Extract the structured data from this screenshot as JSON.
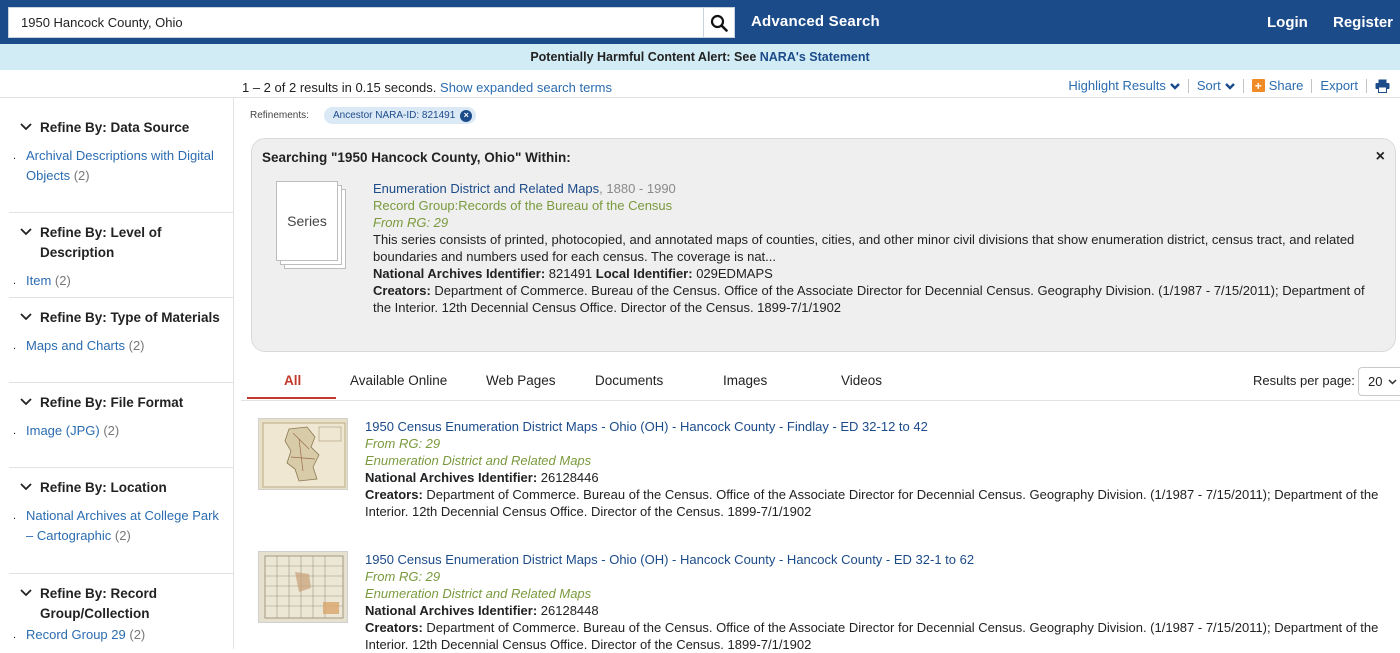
{
  "header": {
    "search_value": "1950 Hancock County, Ohio",
    "advanced_search": "Advanced Search",
    "login": "Login",
    "register": "Register"
  },
  "alert": {
    "text": "Potentially Harmful Content Alert: See ",
    "link": "NARA's Statement"
  },
  "results": {
    "summary": "1 – 2 of 2 results in 0.15 seconds.",
    "expanded_link": "Show expanded search terms"
  },
  "actions": {
    "highlight": "Highlight Results",
    "sort": "Sort",
    "share": "Share",
    "export": "Export"
  },
  "sidebar": [
    {
      "title": "Refine By: Data Source",
      "item": "Archival Descriptions with Digital Objects",
      "count": "(2)"
    },
    {
      "title": "Refine By: Level of Description",
      "item": "Item",
      "count": "(2)"
    },
    {
      "title": "Refine By: Type of Materials",
      "item": "Maps and Charts",
      "count": "(2)"
    },
    {
      "title": "Refine By: File Format",
      "item": "Image (JPG)",
      "count": "(2)"
    },
    {
      "title": "Refine By: Location",
      "item": "National Archives at College Park – Cartographic",
      "count": "(2)"
    },
    {
      "title": "Refine By: Record Group/Collection",
      "item": "Record Group 29",
      "count": "(2)"
    }
  ],
  "refinements": {
    "label": "Refinements:",
    "chip": "Ancestor NARA-ID: 821491"
  },
  "within": {
    "title": "Searching \"1950 Hancock County, Ohio\" Within:",
    "close": "×",
    "series_label": "Series",
    "series_title": "Enumeration District and Related Maps",
    "series_dates": ", 1880 - 1990",
    "record_group": "Record Group:Records of the Bureau of the Census",
    "from_rg": "From RG: 29",
    "description": "This series consists of printed, photocopied, and annotated maps of counties, cities, and other minor civil divisions that show enumeration district, census tract, and related boundaries and numbers used for each census. The coverage is nat...",
    "nai_label": "National Archives Identifier:",
    "nai_value": " 821491 ",
    "local_label": " Local Identifier:",
    "local_value": " 029EDMAPS",
    "creators_label": "Creators:",
    "creators_value": " Department of Commerce. Bureau of the Census. Office of the Associate Director for Decennial Census. Geography Division. (1/1987 - 7/15/2011); Department of the Interior. 12th Decennial Census Office. Director of the Census. 1899-7/1/1902"
  },
  "tabs": [
    "All",
    "Available Online",
    "Web Pages",
    "Documents",
    "Images",
    "Videos"
  ],
  "results_per_page": {
    "label": "Results per page:",
    "value": "20"
  },
  "items": [
    {
      "title": "1950 Census Enumeration District Maps - Ohio (OH) - Hancock County - Findlay - ED 32-12 to 42",
      "from_rg": "From RG: 29",
      "series": "Enumeration District and Related Maps",
      "nai_label": "National Archives Identifier:",
      "nai_value": " 26128446",
      "creators_label": "Creators:",
      "creators_value": " Department of Commerce. Bureau of the Census. Office of the Associate Director for Decennial Census. Geography Division. (1/1987 - 7/15/2011); Department of the Interior. 12th Decennial Census Office. Director of the Census. 1899-7/1/1902"
    },
    {
      "title": "1950 Census Enumeration District Maps - Ohio (OH) - Hancock County - Hancock County - ED 32-1 to 62",
      "from_rg": "From RG: 29",
      "series": "Enumeration District and Related Maps",
      "nai_label": "National Archives Identifier:",
      "nai_value": " 26128448",
      "creators_label": "Creators:",
      "creators_value": " Department of Commerce. Bureau of the Census. Office of the Associate Director for Decennial Census. Geography Division. (1/1987 - 7/15/2011); Department of the Interior. 12th Decennial Census Office. Director of the Census. 1899-7/1/1902"
    }
  ],
  "colors": {
    "header_bg": "#1c4b8a",
    "alert_bg": "#d2ecf6",
    "link": "#2b6cb0",
    "green": "#7a9a3d",
    "active_tab": "#c0392b"
  }
}
